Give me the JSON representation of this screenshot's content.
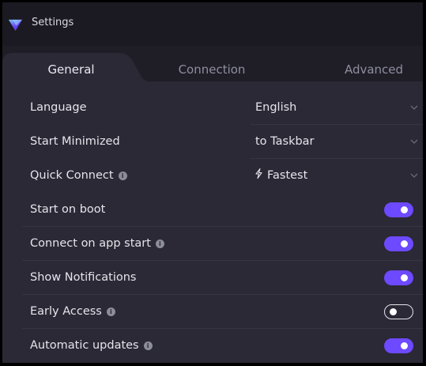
{
  "window": {
    "title": "Settings",
    "logo_icon": "proton-vpn-triangle-icon"
  },
  "tabs": [
    {
      "label": "General",
      "active": true
    },
    {
      "label": "Connection",
      "active": false
    },
    {
      "label": "Advanced",
      "active": false
    }
  ],
  "settings": {
    "language": {
      "label": "Language",
      "value": "English"
    },
    "start_minimized": {
      "label": "Start Minimized",
      "value": "to Taskbar"
    },
    "quick_connect": {
      "label": "Quick Connect",
      "value": "Fastest",
      "value_icon": "lightning-bolt-icon"
    },
    "start_on_boot": {
      "label": "Start on boot",
      "enabled": true
    },
    "connect_on_app_start": {
      "label": "Connect on app start",
      "enabled": true
    },
    "show_notifications": {
      "label": "Show Notifications",
      "enabled": true
    },
    "early_access": {
      "label": "Early Access",
      "enabled": false
    },
    "automatic_updates": {
      "label": "Automatic updates",
      "enabled": true
    }
  },
  "colors": {
    "accent": "#6d4aff",
    "background": "#2a2935",
    "titlebar": "#1b1a22",
    "tabbar": "#1f1e27"
  }
}
